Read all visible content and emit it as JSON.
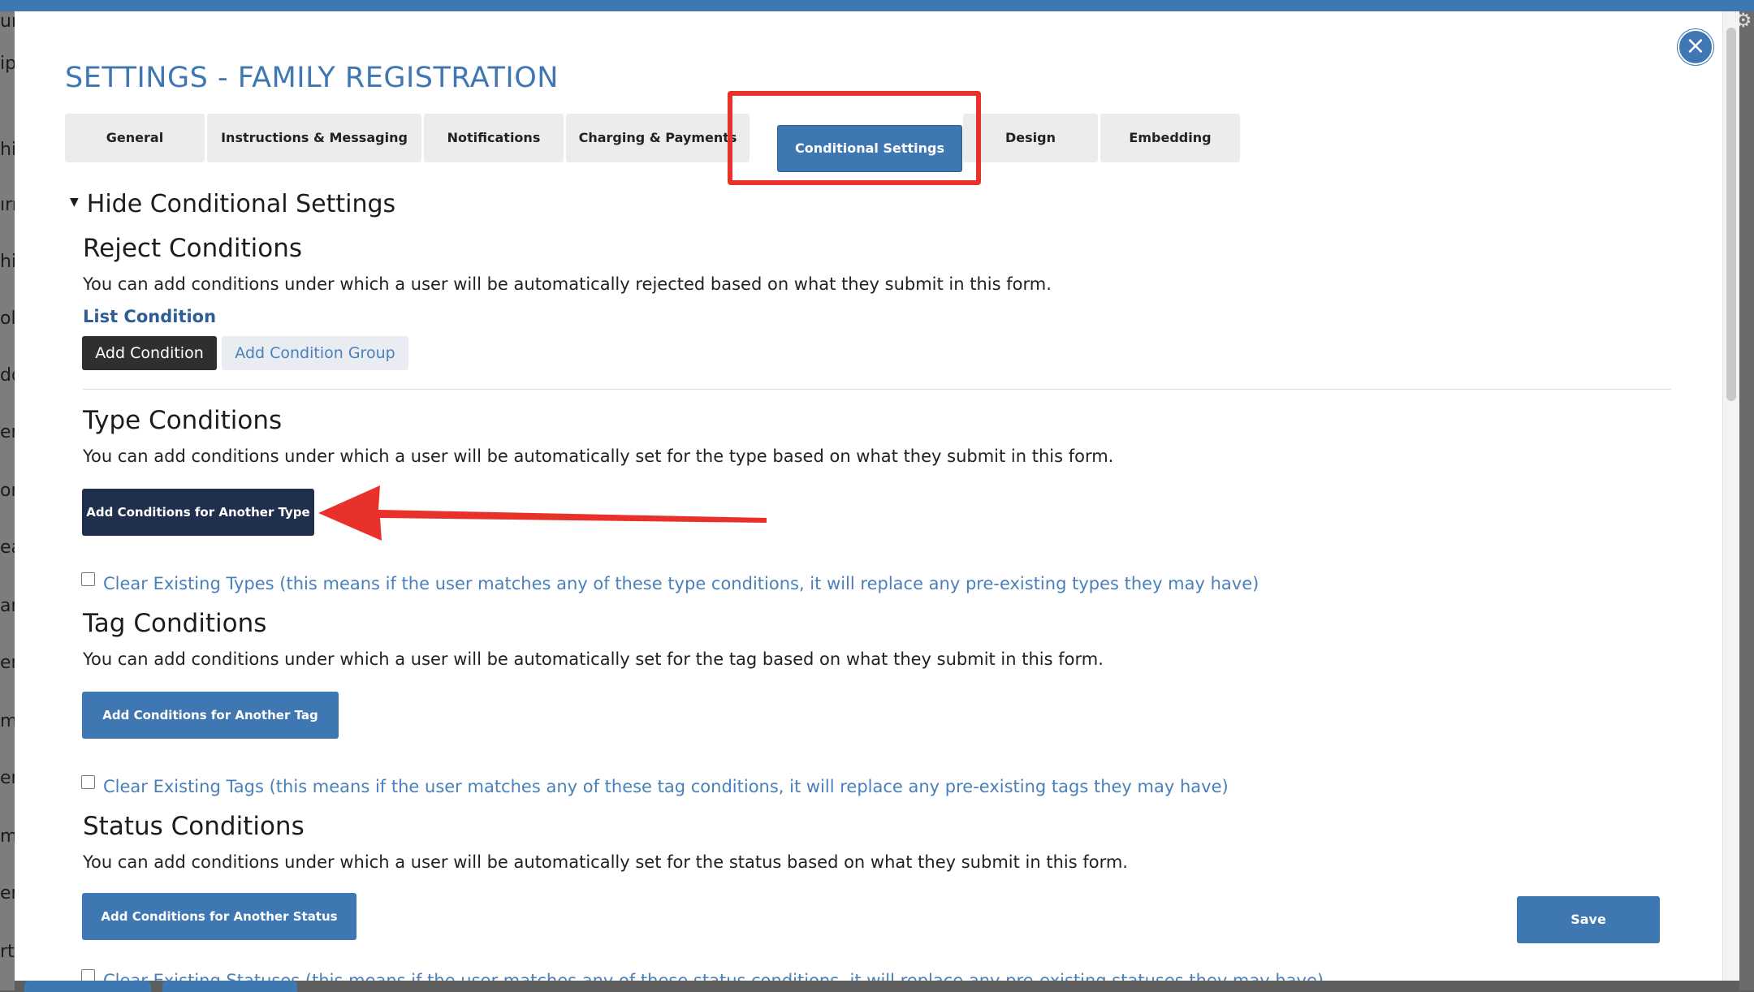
{
  "window": {
    "title": "SETTINGS - FAMILY REGISTRATION",
    "close_label": "×"
  },
  "background": {
    "fragments": [
      "un",
      "ip",
      "hic",
      "ırn",
      "hild",
      "ol",
      "dd",
      "er",
      "on",
      "ea",
      "an",
      "er",
      "m",
      "er",
      "m",
      "er",
      "rt"
    ]
  },
  "tabs": [
    {
      "label": "General"
    },
    {
      "label": "Instructions & Messaging"
    },
    {
      "label": "Notifications"
    },
    {
      "label": "Charging & Payments"
    },
    {
      "label": "Conditional Settings",
      "active": true
    },
    {
      "label": "Design"
    },
    {
      "label": "Embedding"
    }
  ],
  "toggle": {
    "label": "Hide Conditional Settings"
  },
  "reject": {
    "title": "Reject Conditions",
    "description": "You can add conditions under which a user will be automatically rejected based on what they submit in this form.",
    "list_label": "List Condition",
    "add_condition": "Add Condition",
    "add_group": "Add Condition Group"
  },
  "type": {
    "title": "Type Conditions",
    "description": "You can add conditions under which a user will be automatically set for the type based on what they submit in this form.",
    "button": "Add Conditions for Another Type",
    "clear_label": "Clear Existing Types (this means if the user matches any of these type conditions, it will replace any pre-existing types they may have)"
  },
  "tag": {
    "title": "Tag Conditions",
    "description": "You can add conditions under which a user will be automatically set for the tag based on what they submit in this form.",
    "button": "Add Conditions for Another Tag",
    "clear_label": "Clear Existing Tags (this means if the user matches any of these tag conditions, it will replace any pre-existing tags they may have)"
  },
  "status": {
    "title": "Status Conditions",
    "description": "You can add conditions under which a user will be automatically set for the status based on what they submit in this form.",
    "button": "Add Conditions for Another Status",
    "clear_label": "Clear Existing Statuses (this means if the user matches any of these status conditions, it will replace any pre-existing statuses they may have)"
  },
  "save_label": "Save",
  "colors": {
    "accent": "#3f77b3",
    "annotation": "#e8312a",
    "navy_button": "#1f2f4d"
  }
}
